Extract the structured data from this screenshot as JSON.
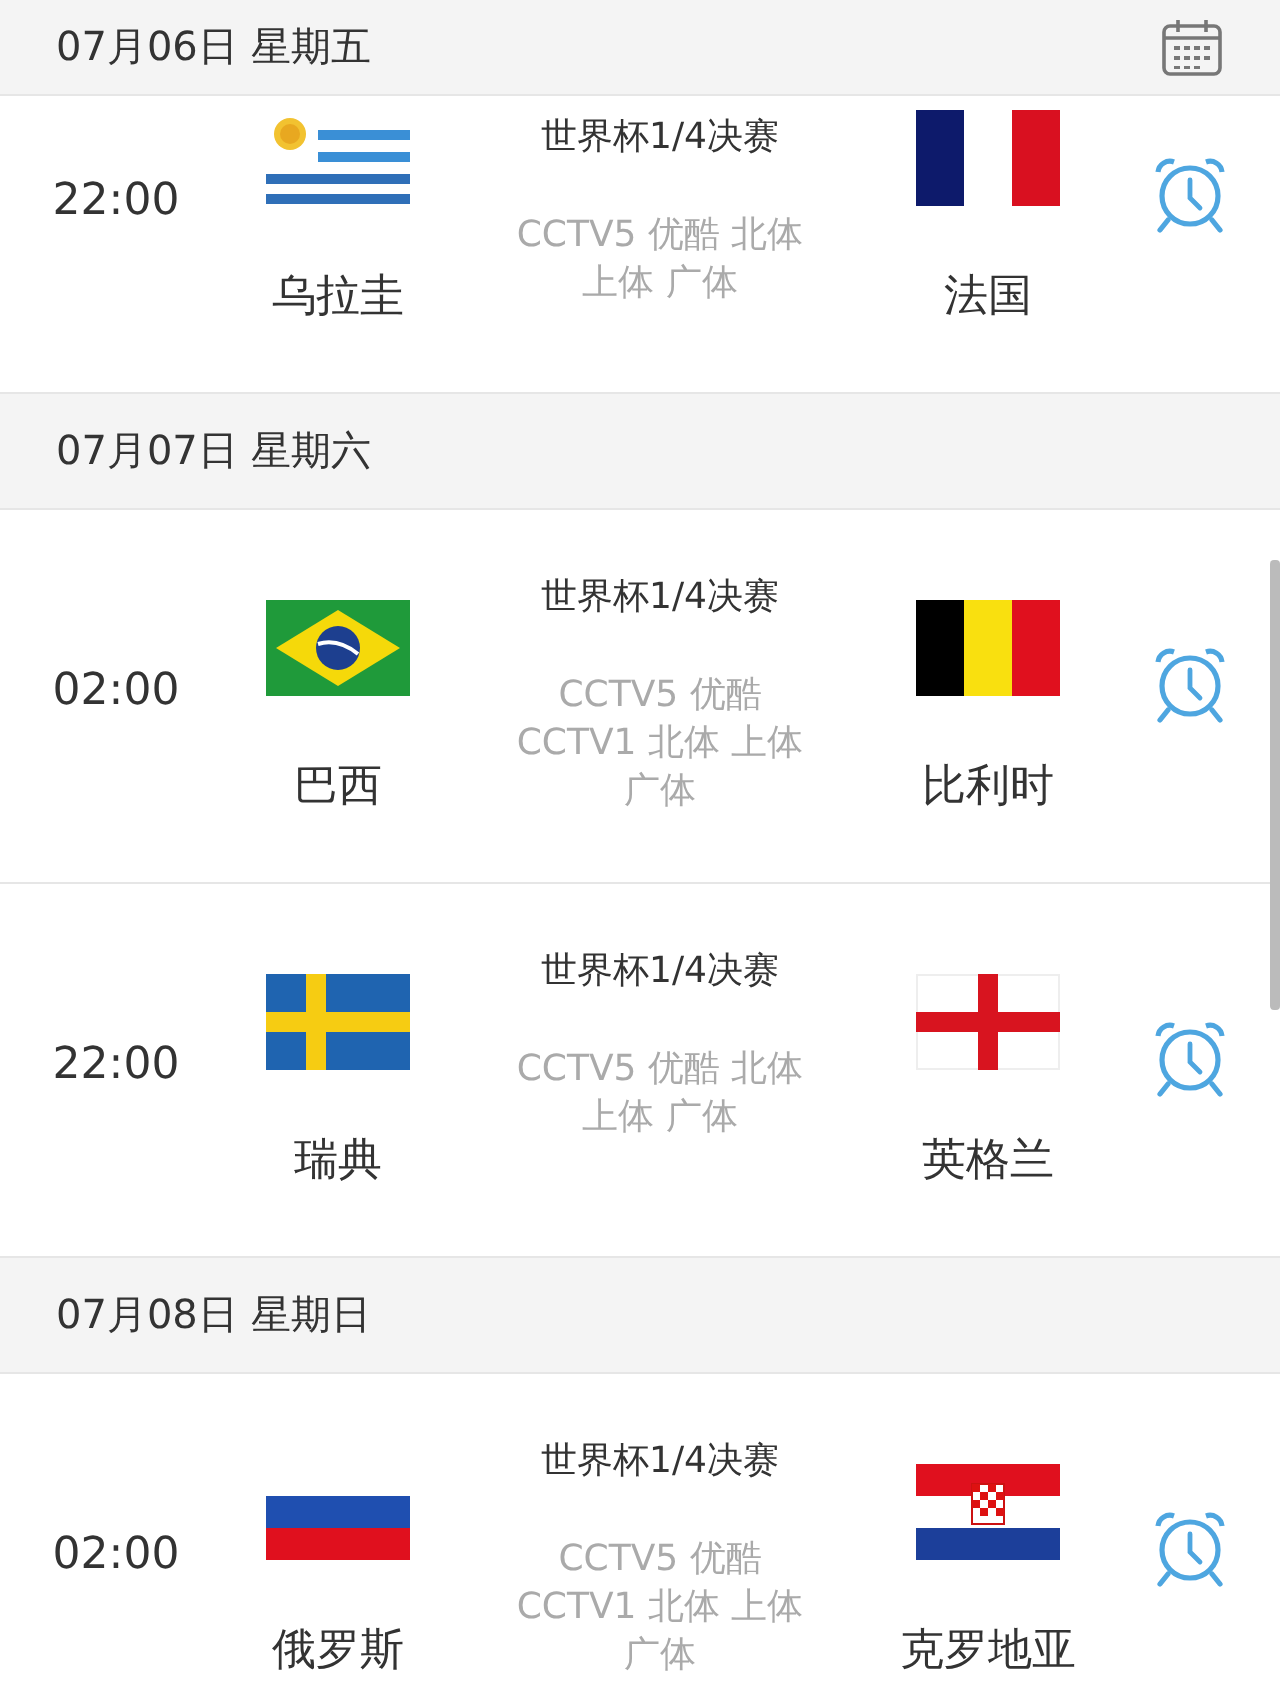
{
  "days": [
    {
      "date": "07月06日 星期五",
      "matches": [
        {
          "time": "22:00",
          "home": {
            "name": "乌拉圭",
            "kind": "uruguay"
          },
          "competition": "世界杯1/4决赛",
          "channels": [
            "CCTV5 优酷 北体",
            "上体 广体"
          ],
          "away": {
            "name": "法国",
            "kind": "france"
          }
        }
      ]
    },
    {
      "date": "07月07日 星期六",
      "matches": [
        {
          "time": "02:00",
          "home": {
            "name": "巴西",
            "kind": "brazil"
          },
          "competition": "世界杯1/4决赛",
          "channels": [
            "CCTV5 优酷",
            "CCTV1 北体 上体",
            "广体"
          ],
          "away": {
            "name": "比利时",
            "kind": "belgium"
          }
        },
        {
          "time": "22:00",
          "home": {
            "name": "瑞典",
            "kind": "sweden"
          },
          "competition": "世界杯1/4决赛",
          "channels": [
            "CCTV5 优酷 北体",
            "上体 广体"
          ],
          "away": {
            "name": "英格兰",
            "kind": "england"
          }
        }
      ]
    },
    {
      "date": "07月08日 星期日",
      "matches": [
        {
          "time": "02:00",
          "home": {
            "name": "俄罗斯",
            "kind": "russia"
          },
          "competition": "世界杯1/4决赛",
          "channels": [
            "CCTV5 优酷",
            "CCTV1 北体 上体",
            "广体"
          ],
          "away": {
            "name": "克罗地亚",
            "kind": "croatia"
          }
        }
      ]
    }
  ]
}
